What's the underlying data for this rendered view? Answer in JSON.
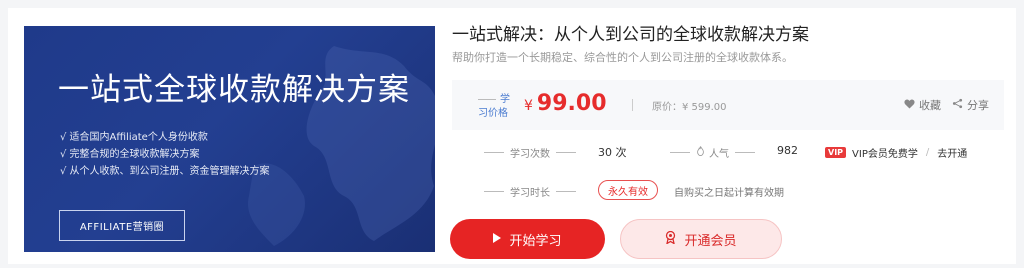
{
  "cover": {
    "title": "一站式全球收款解决方案",
    "points": [
      "√ 适合国内Affiliate个人身份收款",
      "√ 完整合规的全球收款解决方案",
      "√ 从个人收款、到公司注册、资金管理解决方案"
    ],
    "tag_button": "AFFILIATE营销圈"
  },
  "course": {
    "title": "一站式解决：从个人到公司的全球收款解决方案",
    "description": "帮助你打造一个长期稳定、综合性的个人到公司注册的全球收款体系。"
  },
  "price": {
    "label": "学习价格",
    "currency": "¥",
    "amount": "99.00",
    "original": "原价：¥ 599.00",
    "favorite": "收藏",
    "share": "分享"
  },
  "stats": {
    "study_count_label": "学习次数",
    "study_count_value": "30 次",
    "popularity_label": "人气",
    "popularity_value": "982",
    "vip_badge": "VIP",
    "vip_free": "VIP会员免费学",
    "vip_separator": "/",
    "vip_open": "去开通",
    "duration_label": "学习时长",
    "duration_value": "永久有效",
    "duration_note": "自购买之日起计算有效期"
  },
  "actions": {
    "start": "开始学习",
    "vip": "开通会员"
  },
  "colors": {
    "accent": "#e62424",
    "cover_bg": "#233f91"
  }
}
